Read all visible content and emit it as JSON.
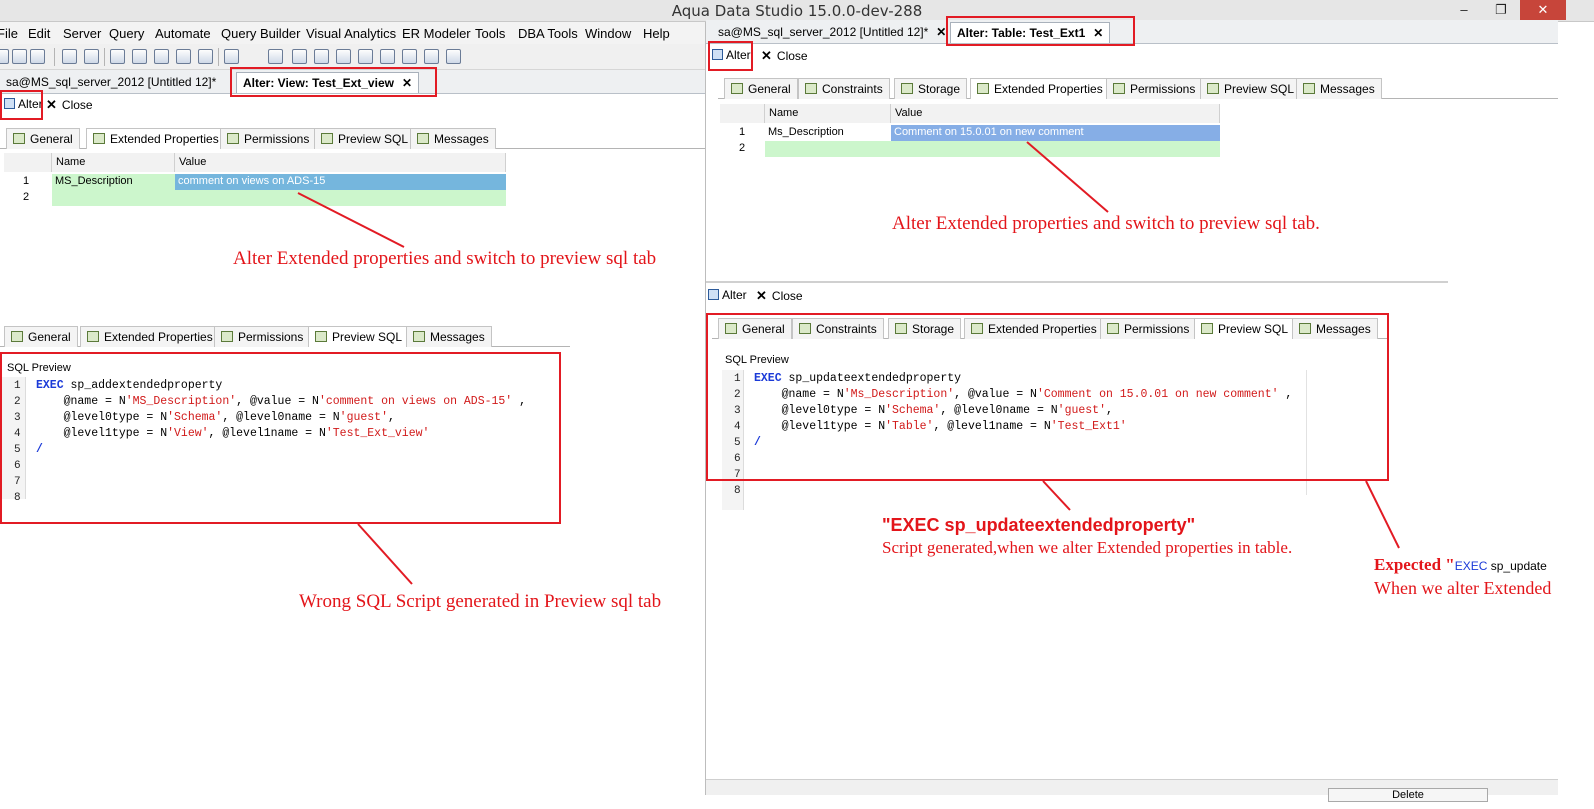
{
  "window": {
    "title": "Aqua Data Studio 15.0.0-dev-288",
    "min": "–",
    "max": "❐",
    "close": "✕"
  },
  "menu": [
    "File",
    "Edit",
    "Server",
    "Query",
    "Automate",
    "Query Builder",
    "Visual Analytics",
    "ER Modeler",
    "Tools",
    "DBA Tools",
    "Window",
    "Help"
  ],
  "left": {
    "doc_tabs": [
      {
        "label": "sa@MS_sql_server_2012 [Untitled 12]*"
      },
      {
        "label": "Alter: View: Test_Ext_view"
      }
    ],
    "actions": {
      "alter": "Alter",
      "close": "Close"
    },
    "tabs_top": [
      "General",
      "Extended Properties",
      "Permissions",
      "Preview SQL",
      "Messages"
    ],
    "grid": {
      "headers": [
        "Name",
        "Value"
      ],
      "rows": [
        {
          "num": "1",
          "name": "MS_Description",
          "value": "comment on views on ADS-15"
        },
        {
          "num": "2",
          "name": "",
          "value": ""
        }
      ]
    },
    "tabs_bottom": [
      "General",
      "Extended Properties",
      "Permissions",
      "Preview SQL",
      "Messages"
    ],
    "sql_label": "SQL Preview",
    "sql_line_numbers": [
      "1",
      "2",
      "3",
      "4",
      "5",
      "6",
      "7",
      "8"
    ],
    "sql": {
      "l1_kw": "EXEC",
      "l1_rest": " sp_addextendedproperty",
      "l2_a": "    @name = N",
      "l2_s1": "'MS_Description'",
      "l2_b": ", @value = N",
      "l2_s2": "'comment on views on ADS-15'",
      "l2_c": " ,",
      "l3_a": "    @level0type = N",
      "l3_s1": "'Schema'",
      "l3_b": ", @level0name = N",
      "l3_s2": "'guest'",
      "l3_c": ",",
      "l4_a": "    @level1type = N",
      "l4_s1": "'View'",
      "l4_b": ", @level1name = N",
      "l4_s2": "'Test_Ext_view'",
      "l5": "/"
    },
    "note_alter": "Alter Extended properties and switch to preview sql tab",
    "note_wrong": "Wrong SQL Script generated in Preview sql tab"
  },
  "right": {
    "doc_tabs": [
      {
        "label": "sa@MS_sql_server_2012 [Untitled 12]*"
      },
      {
        "label": "Alter: Table: Test_Ext1"
      }
    ],
    "actions": {
      "alter": "Alter",
      "close": "Close"
    },
    "tabs_top": [
      "General",
      "Constraints",
      "Storage",
      "Extended Properties",
      "Permissions",
      "Preview SQL",
      "Messages"
    ],
    "grid": {
      "headers": [
        "Name",
        "Value"
      ],
      "rows": [
        {
          "num": "1",
          "name": "Ms_Description",
          "value": "Comment on 15.0.01 on new comment"
        },
        {
          "num": "2",
          "name": "",
          "value": ""
        }
      ]
    },
    "note_alter": "Alter Extended properties and switch to preview sql tab.",
    "actions2": {
      "alter": "Alter",
      "close": "Close"
    },
    "tabs_bottom": [
      "General",
      "Constraints",
      "Storage",
      "Extended Properties",
      "Permissions",
      "Preview SQL",
      "Messages"
    ],
    "sql_label": "SQL Preview",
    "sql_line_numbers": [
      "1",
      "2",
      "3",
      "4",
      "5",
      "6",
      "7",
      "8"
    ],
    "sql": {
      "l1_kw": "EXEC",
      "l1_rest": " sp_updateextendedproperty",
      "l2_a": "    @name = N",
      "l2_s1": "'Ms_Description'",
      "l2_b": ", @value = N",
      "l2_s2": "'Comment on 15.0.01 on new comment'",
      "l2_c": " ,",
      "l3_a": "    @level0type = N",
      "l3_s1": "'Schema'",
      "l3_b": ", @level0name = N",
      "l3_s2": "'guest'",
      "l3_c": ",",
      "l4_a": "    @level1type = N",
      "l4_s1": "'Table'",
      "l4_b": ", @level1name = N",
      "l4_s2": "'Test_Ext1'",
      "l5": "/"
    },
    "note_exec_title": "\"EXEC sp_updateextendedproperty\"",
    "note_exec_sub": "Script generated,when we alter Extended properties in table.",
    "note_expected_a": "Expected \"",
    "note_expected_b": "EXEC",
    "note_expected_c": " sp_update",
    "note_expected_2": "When we alter Extended",
    "bottom_button": "Delete"
  },
  "colors": {
    "annotation": "#e21b24",
    "selection": "#75b6dd",
    "new_row": "#ccf6cc",
    "keyword": "#1b3ad8",
    "string": "#d11a1a"
  }
}
